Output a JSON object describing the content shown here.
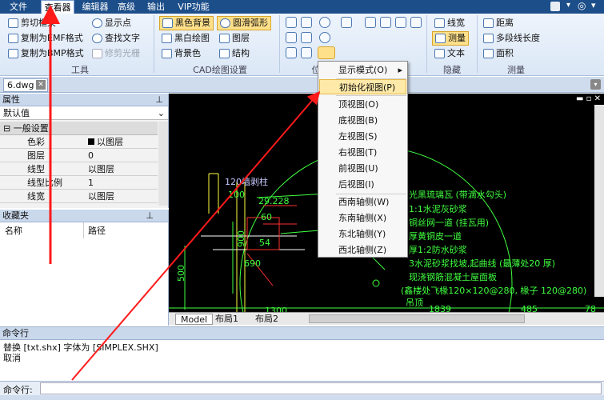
{
  "menubar": {
    "items": [
      "文件",
      "查看器",
      "编辑器",
      "高级",
      "输出",
      "VIP功能"
    ]
  },
  "ribbon": {
    "tools": [
      "剪切框架",
      "复制为EMF格式",
      "复制为BMP格式"
    ],
    "tools2": [
      "显示点",
      "查找文字",
      "修剪光栅"
    ],
    "cad": [
      "黑色背景",
      "黑白绘图",
      "背景色"
    ],
    "cad2": [
      "圆滑弧形",
      "图层",
      "结构"
    ],
    "hide": [
      "线宽",
      "测量",
      "文本"
    ],
    "measure": [
      "距离",
      "多段线长度",
      "面积"
    ],
    "groups": {
      "tools": "工具",
      "cad": "CAD绘图设置",
      "pos": "位",
      "hide": "隐藏",
      "measure": "测量"
    }
  },
  "doc_tab": "6.dwg",
  "props": {
    "title": "属性",
    "default": "默认值",
    "section": "一般设置",
    "rows": [
      [
        "色彩",
        "以图层"
      ],
      [
        "图层",
        "0"
      ],
      [
        "线型",
        "以图层"
      ],
      [
        "线型比例",
        "1"
      ],
      [
        "线宽",
        "以图层"
      ]
    ]
  },
  "fav": {
    "title": "收藏夹",
    "col_name": "名称",
    "col_path": "路径"
  },
  "popup": {
    "items": [
      "显示模式(O)",
      "初始化视图(P)",
      "顶视图(O)",
      "底视图(B)",
      "左视图(S)",
      "右视图(T)",
      "前视图(U)",
      "后视图(I)",
      "西南轴侧(W)",
      "东南轴侧(X)",
      "东北轴侧(Y)",
      "西北轴侧(Z)"
    ]
  },
  "drawing": {
    "texts": [
      "120墙剥柱",
      "100",
      "29.228",
      "60",
      "900",
      "54",
      "690",
      "500",
      "1300",
      "1839",
      "485",
      "78",
      "光黑琉璃瓦 (带滴水勾头)",
      "1:1水泥灰砂浆",
      "铜丝网一道 (挂瓦用)",
      "厚黄铜皮一道",
      "厚1:2防水砂浆",
      "3水泥砂浆找坡,起曲线 (最薄处20 厚)",
      "现浇钢筋混凝土屋面板",
      "(鑫楼处飞椽120×120@280, 椽子  120@280)",
      "吊顶"
    ]
  },
  "layout_tabs": [
    "Model",
    "布局1",
    "布局2"
  ],
  "cmd": {
    "title": "命令行",
    "lines": [
      "替换 [txt.shx] 字体为 [SIMPLEX.SHX]",
      "取消"
    ],
    "prompt": "命令行:"
  },
  "colors": {
    "menubar": "#1c4e8a",
    "canvas": "#000000",
    "drawing": "#40ff40",
    "annotation": "#ff0000"
  }
}
